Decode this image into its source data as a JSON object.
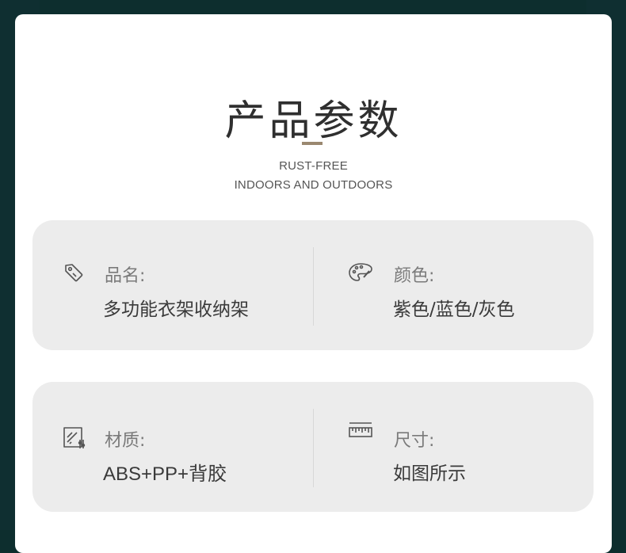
{
  "header": {
    "title": "产品参数",
    "subtitle_line1": "RUST-FREE",
    "subtitle_line2": "INDOORS AND OUTDOORS"
  },
  "specs": [
    {
      "icon": "tag-icon",
      "label": "品名:",
      "value": "多功能衣架收纳架"
    },
    {
      "icon": "palette-icon",
      "label": "颜色:",
      "value": "紫色/蓝色/灰色"
    },
    {
      "icon": "material-icon",
      "label": "材质:",
      "value": "ABS+PP+背胶"
    },
    {
      "icon": "ruler-icon",
      "label": "尺寸:",
      "value": "如图所示"
    }
  ],
  "colors": {
    "background": "#0d2e2e",
    "card": "#ffffff",
    "panel": "#ececec",
    "accent_divider": "#9a8870",
    "title": "#2f2f2f",
    "label": "#7a7a7a",
    "value": "#3a3a3a"
  }
}
